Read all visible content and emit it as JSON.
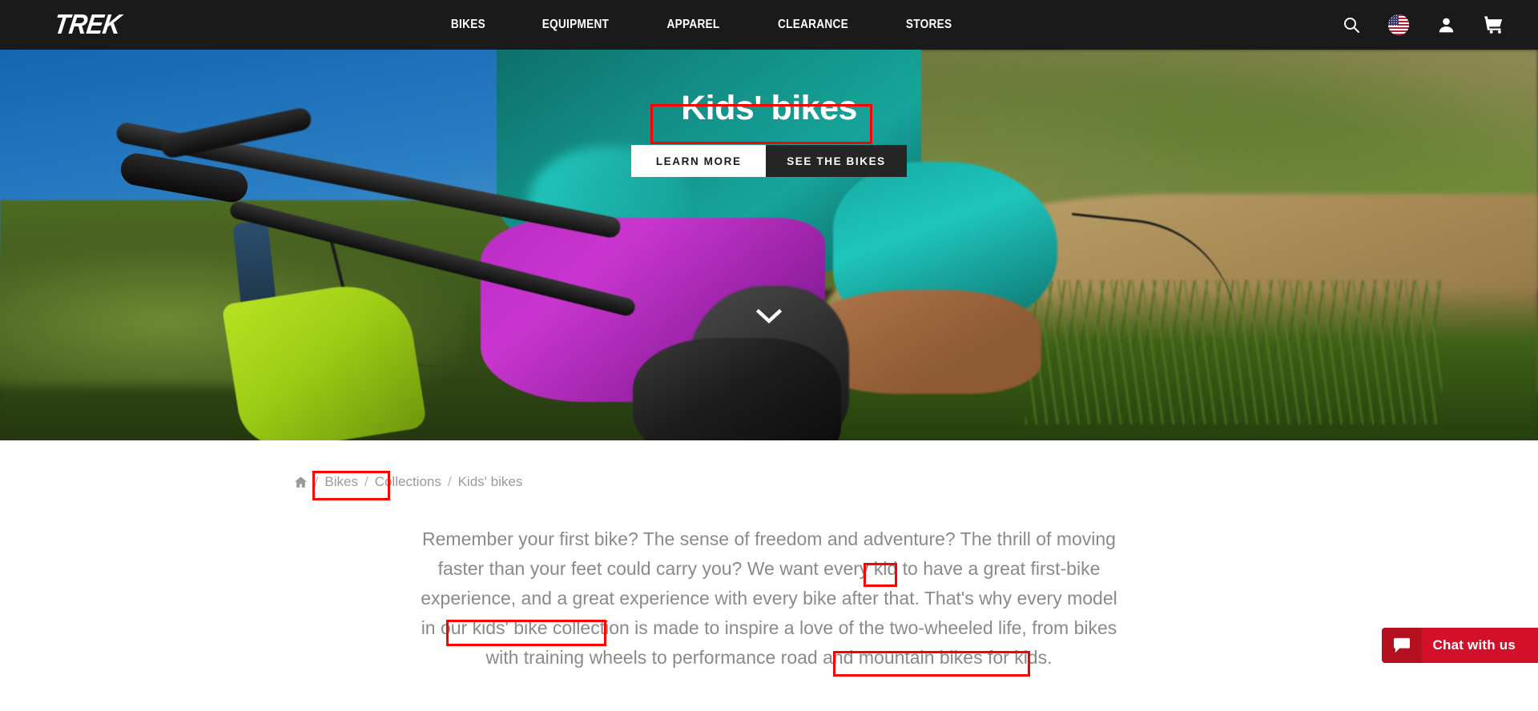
{
  "header": {
    "logo": "TREK",
    "nav": [
      {
        "label": "BIKES"
      },
      {
        "label": "EQUIPMENT"
      },
      {
        "label": "APPAREL"
      },
      {
        "label": "CLEARANCE"
      },
      {
        "label": "STORES"
      }
    ],
    "icons": [
      {
        "name": "search-icon"
      },
      {
        "name": "flag-icon"
      },
      {
        "name": "account-icon"
      },
      {
        "name": "cart-icon"
      }
    ],
    "background": "#1a1a1a"
  },
  "hero": {
    "title": "Kids' bikes",
    "buttons": {
      "primary": "LEARN MORE",
      "secondary": "SEE THE BIKES"
    },
    "scroll_icon": "chevron-down-icon"
  },
  "breadcrumb": {
    "home_icon": "home-icon",
    "items": [
      {
        "label": "Bikes"
      },
      {
        "label": "Collections"
      },
      {
        "label": "Kids' bikes"
      }
    ],
    "separator": "/"
  },
  "intro": {
    "part1": "Remember your first bike? The sense of freedom and adventure? The thrill of moving faster than your feet could carry you? We want every ",
    "highlight1": "kid",
    "part2": " to have a great first-bike experience, and a great experience with every bike after that.  That's why every model in our ",
    "highlight2": "kids' bike collection",
    "part3": " is made to inspire a love of the two-wheeled life, from bikes with training wheels to performance road and ",
    "highlight3": "mountain bikes for kids.",
    "text_color": "#8a8a8a"
  },
  "chat": {
    "label": "Chat with us",
    "icon": "chat-bubble-icon",
    "color": "#d3102a"
  },
  "annotations": {
    "color": "#ff0000",
    "boxes": [
      {
        "target": "hero-title"
      },
      {
        "target": "breadcrumb-current"
      },
      {
        "target": "intro-kid"
      },
      {
        "target": "intro-collection"
      },
      {
        "target": "intro-mountain"
      }
    ]
  }
}
